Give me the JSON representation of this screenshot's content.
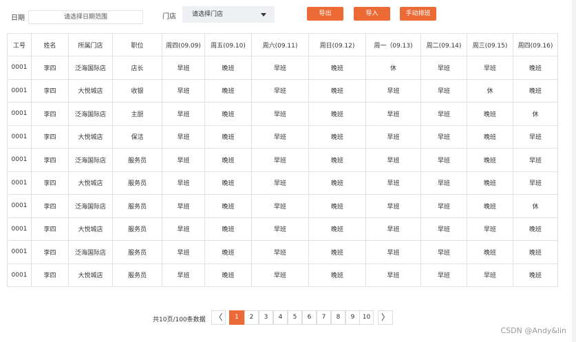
{
  "filters": {
    "date_label": "日期",
    "date_placeholder": "请选择日期范围",
    "store_label": "门店",
    "store_placeholder": "请选择门店"
  },
  "buttons": {
    "export": "导出",
    "import": "导入",
    "manual_schedule": "手动排班"
  },
  "table": {
    "headers": [
      "工号",
      "姓名",
      "所属门店",
      "职位",
      "周四(09.09)",
      "周五(09.10)",
      "周六(09.11)",
      "周日(09.12)",
      "周一（09.13)",
      "周二(09.14)",
      "周三(09.15)",
      "周四(09.16)"
    ],
    "rows": [
      [
        "0001",
        "李四",
        "泛海国际店",
        "店长",
        "早班",
        "晚班",
        "早班",
        "晚班",
        "休",
        "早班",
        "早班",
        "晚班"
      ],
      [
        "0001",
        "李四",
        "大悦城店",
        "收银",
        "早班",
        "晚班",
        "早班",
        "晚班",
        "早班",
        "早班",
        "休",
        "晚班"
      ],
      [
        "0001",
        "李四",
        "泛海国际店",
        "主厨",
        "早班",
        "晚班",
        "早班",
        "晚班",
        "早班",
        "早班",
        "晚班",
        "休"
      ],
      [
        "0001",
        "李四",
        "大悦城店",
        "保洁",
        "早班",
        "晚班",
        "早班",
        "晚班",
        "早班",
        "早班",
        "晚班",
        "早班"
      ],
      [
        "0001",
        "李四",
        "泛海国际店",
        "服务员",
        "早班",
        "晚班",
        "早班",
        "晚班",
        "早班",
        "早班",
        "晚班",
        "早班"
      ],
      [
        "0001",
        "李四",
        "大悦城店",
        "服务员",
        "早班",
        "晚班",
        "早班",
        "晚班",
        "早班",
        "早班",
        "晚班",
        "早班"
      ],
      [
        "0001",
        "李四",
        "泛海国际店",
        "服务员",
        "早班",
        "晚班",
        "早班",
        "晚班",
        "早班",
        "早班",
        "晚班",
        "休"
      ],
      [
        "0001",
        "李四",
        "大悦城店",
        "服务员",
        "早班",
        "晚班",
        "早班",
        "晚班",
        "早班",
        "早班",
        "早班",
        "晚班"
      ],
      [
        "0001",
        "李四",
        "泛海国际店",
        "服务员",
        "早班",
        "晚班",
        "早班",
        "晚班",
        "早班",
        "早班",
        "晚班",
        "晚班"
      ],
      [
        "0001",
        "李四",
        "大悦城店",
        "服务员",
        "早班",
        "晚班",
        "早班",
        "晚班",
        "早班",
        "早班",
        "早班",
        "晚班"
      ]
    ]
  },
  "pagination": {
    "summary": "共10页/100条数据",
    "prev_icon": "chevron-left-icon",
    "next_icon": "chevron-right-icon",
    "prev_glyph": "〈",
    "next_glyph": "〉",
    "pages": [
      "1",
      "2",
      "3",
      "4",
      "5",
      "6",
      "7",
      "8",
      "9",
      "10"
    ],
    "current_page": "1"
  },
  "colors": {
    "accent": "#ec6a36",
    "select_bg": "#eef0f4",
    "border": "#e2e2e2"
  },
  "watermark": "CSDN @Andy&lin"
}
